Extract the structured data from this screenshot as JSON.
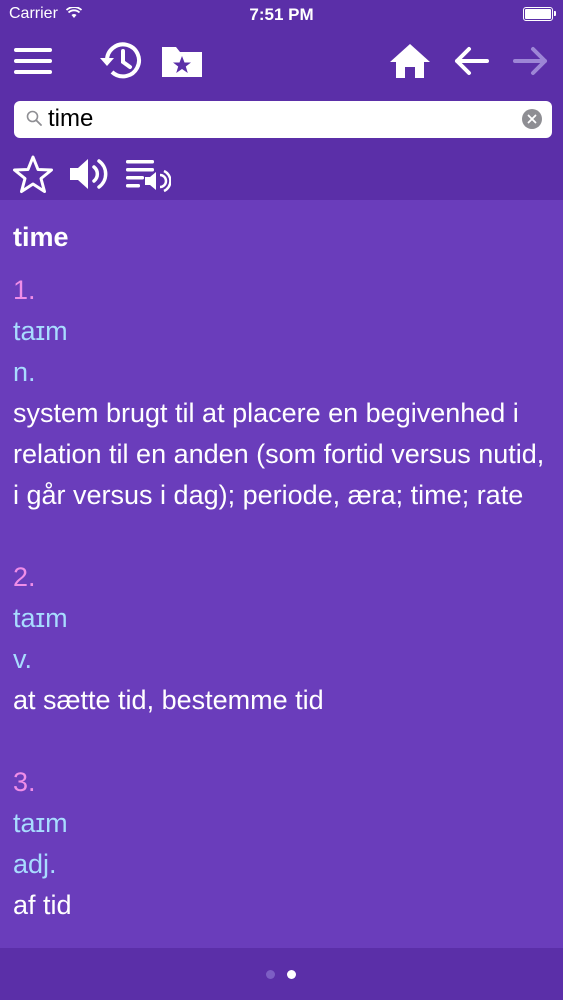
{
  "status": {
    "carrier": "Carrier",
    "time": "7:51 PM"
  },
  "toolbar": {
    "icons": [
      "menu-icon",
      "history-icon",
      "favorites-folder-icon",
      "home-icon",
      "back-arrow-icon",
      "forward-arrow-icon"
    ]
  },
  "search": {
    "value": "time"
  },
  "actions": {
    "icons": [
      "star-icon",
      "speaker-icon",
      "play-list-audio-icon"
    ]
  },
  "entry": {
    "headword": "time",
    "senses": [
      {
        "number": "1.",
        "pronunciation": "taɪm",
        "pos": "n.",
        "definition": "system brugt til at placere en begivenhed i relation til en anden (som fortid versus nutid, i går versus i dag); periode, æra; time; rate"
      },
      {
        "number": "2.",
        "pronunciation": "taɪm",
        "pos": "v.",
        "definition": "at sætte tid, bestemme tid"
      },
      {
        "number": "3.",
        "pronunciation": "taɪm",
        "pos": "adj.",
        "definition": "af tid"
      }
    ]
  },
  "pager": {
    "total": 2,
    "current": 2
  },
  "colors": {
    "bar": "#5b2fa8",
    "content": "#6a3dbb",
    "number": "#f08ee8",
    "pron": "#a8dcff"
  }
}
